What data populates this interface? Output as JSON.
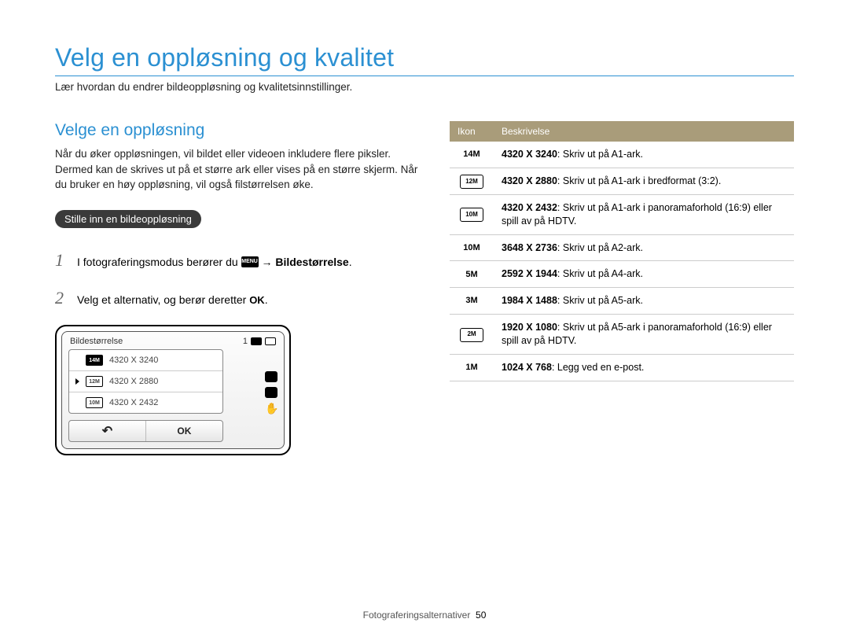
{
  "page": {
    "title": "Velg en oppløsning og kvalitet",
    "subtitle": "Lær hvordan du endrer bildeoppløsning og kvalitetsinnstillinger."
  },
  "left": {
    "heading": "Velge en oppløsning",
    "paragraph": "Når du øker oppløsningen, vil bildet eller videoen inkludere flere piksler. Dermed kan de skrives ut på et større ark eller vises på en større skjerm. Når du bruker en høy oppløsning, vil også filstørrelsen øke.",
    "pill": "Stille inn en bildeoppløsning",
    "step1_pre": "I fotograferingsmodus berører du ",
    "step1_menu_icon": "MENU",
    "step1_arrow": "→",
    "step1_post": "Bildestørrelse",
    "step2_pre": "Velg et alternativ, og berør deretter ",
    "step2_ok": "OK",
    "step2_post": "."
  },
  "device": {
    "title": "Bildestørrelse",
    "counter": "1",
    "items": [
      {
        "icon": "14M",
        "filled": true,
        "label": "4320 X 3240",
        "selected": false
      },
      {
        "icon": "12M",
        "filled": false,
        "label": "4320 X 2880",
        "selected": true
      },
      {
        "icon": "10M",
        "filled": false,
        "label": "4320 X 2432",
        "selected": false
      }
    ],
    "back": "↶",
    "ok": "OK"
  },
  "table": {
    "head_icon": "Ikon",
    "head_desc": "Beskrivelse",
    "rows": [
      {
        "icon_text": "14M",
        "icon_box": false,
        "res": "4320 X 3240",
        "desc": ": Skriv ut på A1-ark."
      },
      {
        "icon_text": "12M",
        "icon_box": true,
        "res": "4320 X 2880",
        "desc": ": Skriv ut på A1-ark i bredformat (3:2)."
      },
      {
        "icon_text": "10M",
        "icon_box": true,
        "res": "4320 X 2432",
        "desc": ": Skriv ut på A1-ark i panoramaforhold (16:9) eller spill av på HDTV."
      },
      {
        "icon_text": "10M",
        "icon_box": false,
        "res": "3648 X 2736",
        "desc": ": Skriv ut på A2-ark."
      },
      {
        "icon_text": "5M",
        "icon_box": false,
        "res": "2592 X 1944",
        "desc": ": Skriv ut på A4-ark."
      },
      {
        "icon_text": "3M",
        "icon_box": false,
        "res": "1984 X 1488",
        "desc": ": Skriv ut på A5-ark."
      },
      {
        "icon_text": "2M",
        "icon_box": true,
        "res": "1920 X 1080",
        "desc": ": Skriv ut på A5-ark i panoramaforhold (16:9) eller spill av på HDTV."
      },
      {
        "icon_text": "1M",
        "icon_box": false,
        "res": "1024 X 768",
        "desc": ": Legg ved en e-post."
      }
    ]
  },
  "footer": {
    "section": "Fotograferingsalternativer",
    "page": "50"
  }
}
